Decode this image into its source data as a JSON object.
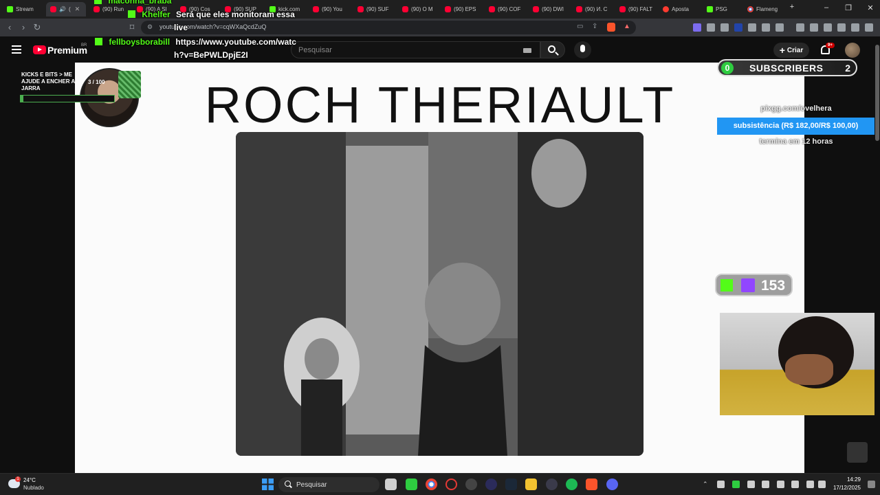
{
  "browser": {
    "tabs": [
      {
        "label": "Stream",
        "icon": "kick"
      },
      {
        "label": "(",
        "icon": "youtube",
        "active": true
      },
      {
        "label": "(90) Run",
        "icon": "youtube"
      },
      {
        "label": "(90) A SI",
        "icon": "youtube"
      },
      {
        "label": "(90) Cos",
        "icon": "youtube"
      },
      {
        "label": "(90) SUP",
        "icon": "youtube"
      },
      {
        "label": "kick.com",
        "icon": "kick"
      },
      {
        "label": "(90) You",
        "icon": "youtube"
      },
      {
        "label": "(90) SUF",
        "icon": "youtube"
      },
      {
        "label": "(90) O M",
        "icon": "youtube"
      },
      {
        "label": "(90) EPS",
        "icon": "youtube"
      },
      {
        "label": "(90) COF",
        "icon": "youtube"
      },
      {
        "label": "(90) DWI",
        "icon": "youtube"
      },
      {
        "label": "(90) И. С",
        "icon": "youtube"
      },
      {
        "label": "(90) FALT",
        "icon": "youtube"
      },
      {
        "label": "Aposta",
        "icon": "sparkle"
      },
      {
        "label": "PSG",
        "icon": "kick"
      },
      {
        "label": "Flameng",
        "icon": "chrome"
      }
    ],
    "new_tab": "+",
    "window_controls": {
      "minimize": "–",
      "restore": "❐",
      "close": "✕"
    },
    "url": "youtube.com/watch?v=cqWXaQcdZuQ"
  },
  "youtube": {
    "brand": "Premium",
    "country_code": "BR",
    "search_placeholder": "Pesquisar",
    "create_label": "Criar",
    "notification_badge": "9+"
  },
  "chat": {
    "line1": {
      "user": "maconha_braba",
      "text": ""
    },
    "line2": {
      "user": "Khelfer",
      "text": "Será que eles monitoram essa"
    },
    "line2b": {
      "text": "live"
    },
    "line3": {
      "user": "fellboysborabill",
      "text": "https://www.youtube.com/watc",
      "text2": "h?v=BePWLDpjE2I"
    }
  },
  "video": {
    "slide_title": "ROCH THERIAULT"
  },
  "overlays": {
    "goal": {
      "label": "KICKS E BITS > ME AJUDE A ENCHER A JARRA",
      "count_text": "3 / 100",
      "progress": 0.03
    },
    "subscribers": {
      "current": "0",
      "label": "SUBSCRIBERS",
      "goal": "2"
    },
    "pix": {
      "line1": "pixgg.com/ovelhera",
      "bar": "subsistência (R$ 182,00/R$ 100,00)",
      "line3": "termina em 12 horas"
    },
    "viewers": "153"
  },
  "taskbar": {
    "weather_temp": "24°C",
    "weather_condition": "Nublado",
    "weather_badge": "1",
    "search_label": "Pesquisar",
    "clock_time": "14:29",
    "clock_date": "17/12/2025"
  },
  "colors": {
    "youtube_red": "#ff0033",
    "kick_green": "#53fc18",
    "twitch_purple": "#9146ff",
    "pix_blue": "#2196f3"
  }
}
